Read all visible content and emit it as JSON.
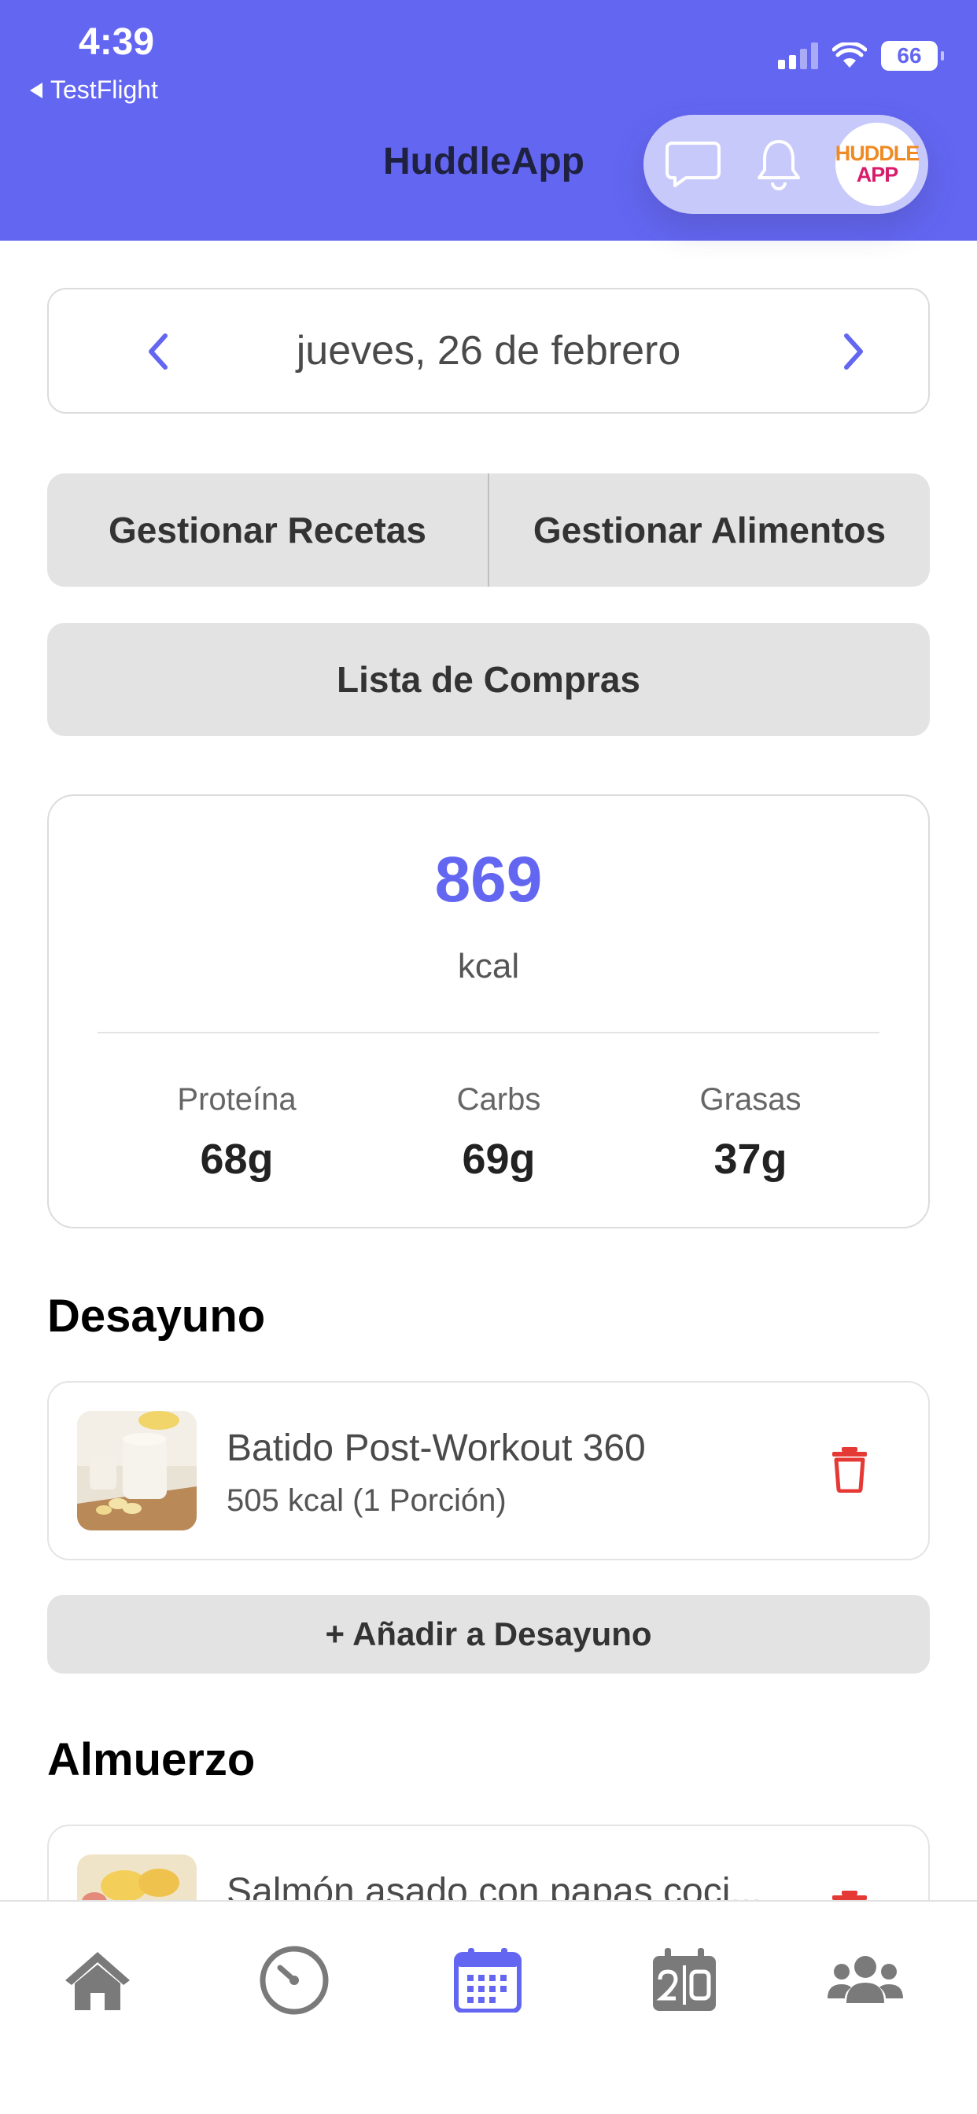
{
  "status_bar": {
    "time": "4:39",
    "back_label": "TestFlight",
    "battery": "66"
  },
  "header": {
    "title": "HuddleApp",
    "logo_line1": "HUDDLE",
    "logo_line2": "APP"
  },
  "date_selector": {
    "label": "jueves, 26 de febrero"
  },
  "buttons": {
    "manage_recipes": "Gestionar Recetas",
    "manage_foods": "Gestionar Alimentos",
    "shopping_list": "Lista de Compras"
  },
  "summary": {
    "calories": "869",
    "unit": "kcal",
    "macros": [
      {
        "label": "Proteína",
        "value": "68g"
      },
      {
        "label": "Carbs",
        "value": "69g"
      },
      {
        "label": "Grasas",
        "value": "37g"
      }
    ]
  },
  "meals": [
    {
      "title": "Desayuno",
      "items": [
        {
          "name": "Batido Post-Workout 360",
          "detail": "505 kcal (1 Porción)"
        }
      ],
      "add_label": "+ Añadir a Desayuno"
    },
    {
      "title": "Almuerzo",
      "items": [
        {
          "name": "Salmón asado con papas coci..."
        }
      ]
    }
  ],
  "tabbar": {
    "items": [
      "home-icon",
      "timer-icon",
      "calendar-icon",
      "scoreboard-icon",
      "group-icon"
    ],
    "active_index": 2,
    "active_color": "#6366f1",
    "inactive_color": "#7a7a7a"
  },
  "colors": {
    "accent": "#6366f1",
    "danger": "#e53935",
    "header_bg": "#6366f1"
  }
}
